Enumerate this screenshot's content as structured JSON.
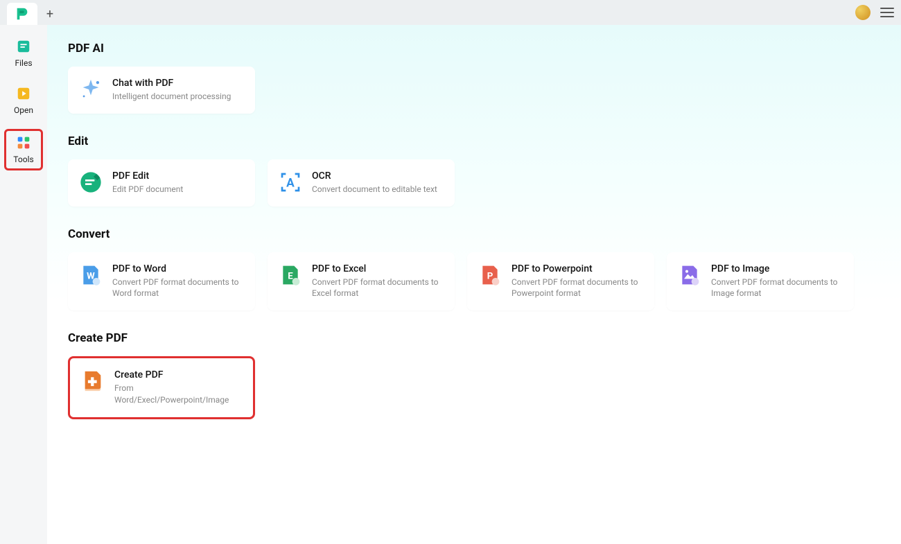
{
  "sidebar": {
    "items": [
      {
        "label": "Files"
      },
      {
        "label": "Open"
      },
      {
        "label": "Tools"
      }
    ]
  },
  "sections": {
    "pdfai": {
      "title": "PDF AI",
      "cards": [
        {
          "title": "Chat with PDF",
          "desc": "Intelligent document processing"
        }
      ]
    },
    "edit": {
      "title": "Edit",
      "cards": [
        {
          "title": "PDF Edit",
          "desc": "Edit PDF document"
        },
        {
          "title": "OCR",
          "desc": "Convert document to editable text"
        }
      ]
    },
    "convert": {
      "title": "Convert",
      "cards": [
        {
          "title": "PDF to Word",
          "desc": "Convert PDF format documents to Word format"
        },
        {
          "title": "PDF to Excel",
          "desc": "Convert PDF format documents to Excel format"
        },
        {
          "title": "PDF to Powerpoint",
          "desc": "Convert PDF format documents to Powerpoint format"
        },
        {
          "title": "PDF to Image",
          "desc": "Convert PDF format documents to Image format"
        }
      ]
    },
    "createpdf": {
      "title": "Create PDF",
      "cards": [
        {
          "title": "Create PDF",
          "desc": "From Word/Execl/Powerpoint/Image"
        }
      ]
    }
  }
}
